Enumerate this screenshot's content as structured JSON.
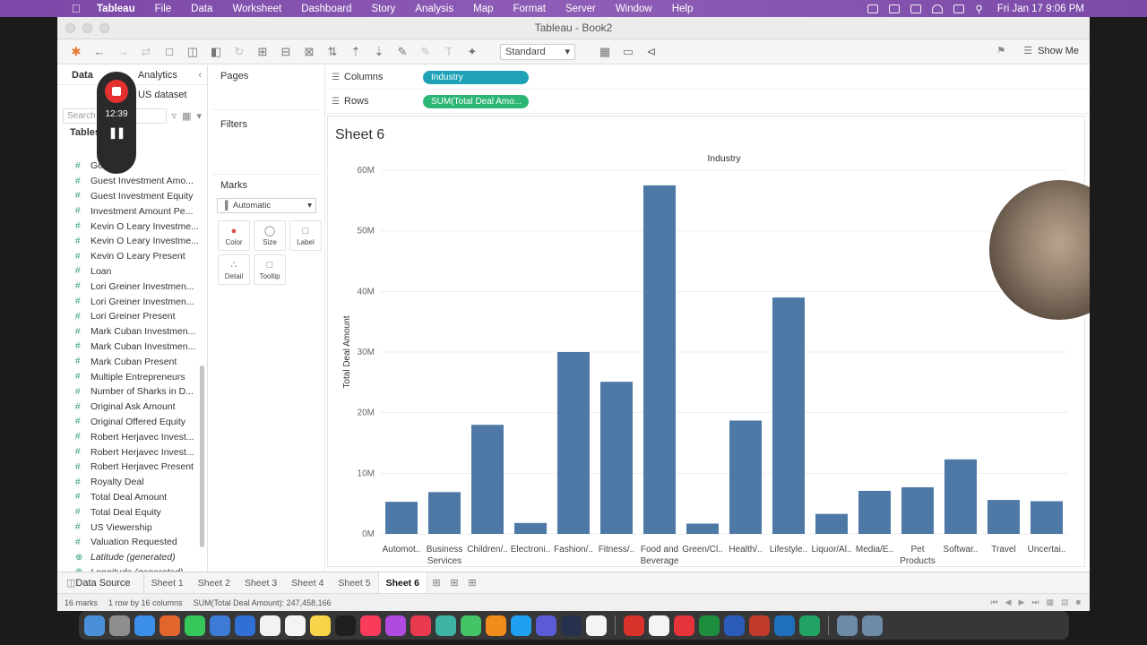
{
  "menubar": {
    "app": "Tableau",
    "items": [
      "File",
      "Data",
      "Worksheet",
      "Dashboard",
      "Story",
      "Analysis",
      "Map",
      "Format",
      "Server",
      "Window",
      "Help"
    ],
    "clock": "Fri Jan 17  9:06 PM"
  },
  "window": {
    "title": "Tableau - Book2"
  },
  "toolbar": {
    "view_mode": "Standard",
    "show_me": "Show Me"
  },
  "left_panel": {
    "tab_data": "Data",
    "tab_analytics": "Analytics",
    "datasource": "US dataset",
    "search_placeholder": "Search",
    "tables_label": "Tables",
    "fields": [
      {
        "name": "Got Deal",
        "type": "measure"
      },
      {
        "name": "Guest Investment Amo...",
        "type": "measure"
      },
      {
        "name": "Guest Investment Equity",
        "type": "measure"
      },
      {
        "name": "Investment Amount Pe...",
        "type": "measure"
      },
      {
        "name": "Kevin O Leary Investme...",
        "type": "measure"
      },
      {
        "name": "Kevin O Leary Investme...",
        "type": "measure"
      },
      {
        "name": "Kevin O Leary Present",
        "type": "measure"
      },
      {
        "name": "Loan",
        "type": "measure"
      },
      {
        "name": "Lori Greiner Investmen...",
        "type": "measure"
      },
      {
        "name": "Lori Greiner Investmen...",
        "type": "measure"
      },
      {
        "name": "Lori Greiner Present",
        "type": "measure"
      },
      {
        "name": "Mark Cuban Investmen...",
        "type": "measure"
      },
      {
        "name": "Mark Cuban Investmen...",
        "type": "measure"
      },
      {
        "name": "Mark Cuban Present",
        "type": "measure"
      },
      {
        "name": "Multiple Entrepreneurs",
        "type": "measure"
      },
      {
        "name": "Number of Sharks in D...",
        "type": "measure"
      },
      {
        "name": "Original Ask Amount",
        "type": "measure"
      },
      {
        "name": "Original Offered Equity",
        "type": "measure"
      },
      {
        "name": "Robert Herjavec Invest...",
        "type": "measure"
      },
      {
        "name": "Robert Herjavec Invest...",
        "type": "measure"
      },
      {
        "name": "Robert Herjavec Present",
        "type": "measure"
      },
      {
        "name": "Royalty Deal",
        "type": "measure"
      },
      {
        "name": "Total Deal Amount",
        "type": "measure"
      },
      {
        "name": "Total Deal Equity",
        "type": "measure"
      },
      {
        "name": "US Viewership",
        "type": "measure"
      },
      {
        "name": "Valuation Requested",
        "type": "measure"
      },
      {
        "name": "Latitude (generated)",
        "type": "geo"
      },
      {
        "name": "Longitude (generated)",
        "type": "geo"
      }
    ]
  },
  "recorder": {
    "time": "12:39"
  },
  "cards": {
    "pages": "Pages",
    "filters": "Filters",
    "marks": "Marks",
    "mark_type": "Automatic",
    "mark_buttons": [
      {
        "label": "Color",
        "icon": "color-icon"
      },
      {
        "label": "Size",
        "icon": "size-icon"
      },
      {
        "label": "Label",
        "icon": "label-icon"
      },
      {
        "label": "Detail",
        "icon": "detail-icon"
      },
      {
        "label": "Tooltip",
        "icon": "tooltip-icon"
      }
    ]
  },
  "shelves": {
    "columns_label": "Columns",
    "columns_pill": "Industry",
    "rows_label": "Rows",
    "rows_pill": "SUM(Total Deal Amo..."
  },
  "sheet": {
    "title": "Sheet 6"
  },
  "chart_data": {
    "type": "bar",
    "title": "Industry",
    "ylabel": "Total Deal Amount",
    "ylim": [
      0,
      60000000
    ],
    "y_ticks": [
      "0M",
      "10M",
      "20M",
      "30M",
      "40M",
      "50M",
      "60M"
    ],
    "y_tick_values": [
      0,
      10000000,
      20000000,
      30000000,
      40000000,
      50000000,
      60000000
    ],
    "bar_color": "#4e79a7",
    "categories": [
      [
        "Automot.."
      ],
      [
        "Business",
        "Services"
      ],
      [
        "Children/.."
      ],
      [
        "Electroni.."
      ],
      [
        "Fashion/.."
      ],
      [
        "Fitness/.."
      ],
      [
        "Food and",
        "Beverage"
      ],
      [
        "Green/Cl.."
      ],
      [
        "Health/.."
      ],
      [
        "Lifestyle.."
      ],
      [
        "Liquor/Al.."
      ],
      [
        "Media/E.."
      ],
      [
        "Pet",
        "Products"
      ],
      [
        "Softwar.."
      ],
      [
        "Travel"
      ],
      [
        "Uncertai.."
      ]
    ],
    "values": [
      5300000,
      6900000,
      18000000,
      1800000,
      30000000,
      25100000,
      57500000,
      1700000,
      18700000,
      39000000,
      3300000,
      7100000,
      7700000,
      12300000,
      5600000,
      5400000
    ]
  },
  "tabs": {
    "data_source": "Data Source",
    "sheets": [
      "Sheet 1",
      "Sheet 2",
      "Sheet 3",
      "Sheet 4",
      "Sheet 5",
      "Sheet 6"
    ],
    "active": "Sheet 6"
  },
  "status": {
    "marks": "16 marks",
    "rows_cols": "1 row by 16 columns",
    "sum": "SUM(Total Deal Amount): 247,458,166"
  },
  "colors": {
    "menubar": "#7b47a8",
    "columns_pill": "#1fa2b8",
    "rows_pill": "#2bb673",
    "bar": "#4e79a7"
  }
}
